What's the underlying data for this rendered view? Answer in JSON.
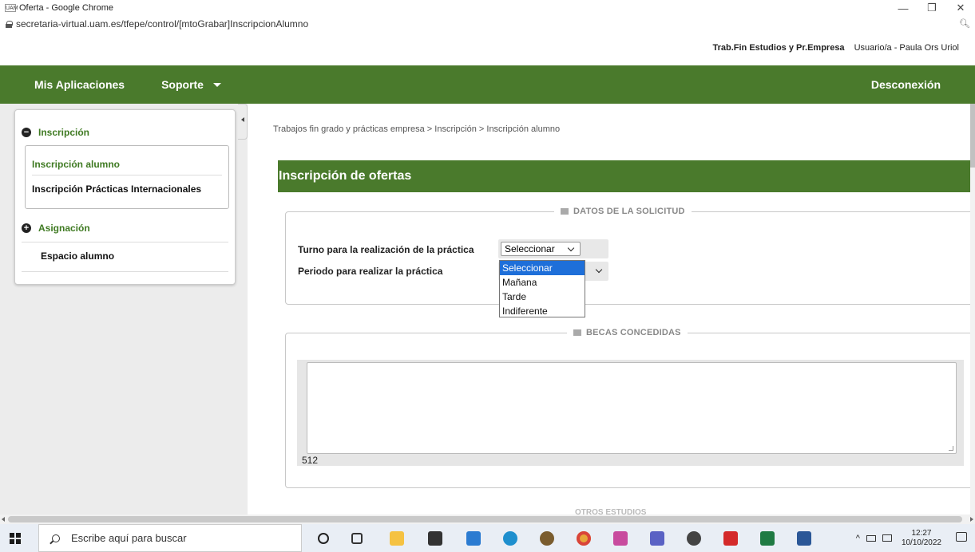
{
  "window": {
    "title": "Oferta - Google Chrome",
    "url": "secretaria-virtual.uam.es/tfepe/control/[mtoGrabar]InscripcionAlumno",
    "minimize": "—",
    "restore": "❐",
    "close": "✕"
  },
  "header": {
    "app_name": "Trab.Fin Estudios y Pr.Empresa",
    "user": "Usuario/a - Paula Ors Uriol"
  },
  "navbar": {
    "mis_aplicaciones": "Mis Aplicaciones",
    "soporte": "Soporte",
    "desconexion": "Desconexión"
  },
  "sidebar": {
    "inscripcion": "Inscripción",
    "inscripcion_alumno": "Inscripción alumno",
    "inscripcion_practicas_int": "Inscripción Prácticas Internacionales",
    "asignacion": "Asignación",
    "espacio_alumno": "Espacio alumno"
  },
  "breadcrumb": "Trabajos fin grado y prácticas empresa > Inscripción > Inscripción alumno",
  "section_title": "Inscripción de ofertas",
  "datos_solicitud": {
    "legend": "DATOS DE LA SOLICITUD",
    "turno_label": "Turno para la realización de la práctica",
    "turno_value": "Seleccionar",
    "periodo_label": "Periodo para realizar la práctica",
    "options": [
      "Seleccionar",
      "Mañana",
      "Tarde",
      "Indiferente"
    ]
  },
  "becas": {
    "legend": "BECAS CONCEDIDAS",
    "counter": "512"
  },
  "next_legend": "OTROS ESTUDIOS",
  "taskbar": {
    "search_placeholder": "Escribe aquí para buscar",
    "time": "12:27",
    "date": "10/10/2022"
  }
}
